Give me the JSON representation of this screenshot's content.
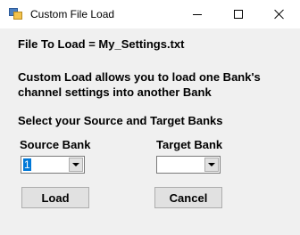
{
  "window": {
    "title": "Custom File Load"
  },
  "file_to_load": "File To Load = My_Settings.txt",
  "description": {
    "line1": "Custom Load allows you to load one Bank's",
    "line2": "channel settings into another Bank"
  },
  "select_prompt": "Select your Source and Target Banks",
  "source_bank": {
    "label": "Source Bank",
    "selected_value": "1"
  },
  "target_bank": {
    "label": "Target Bank",
    "selected_value": ""
  },
  "buttons": {
    "load": "Load",
    "cancel": "Cancel"
  },
  "colors": {
    "selection": "#0078d7",
    "window_bg": "#f0f0f0",
    "titlebar_bg": "#ffffff"
  }
}
